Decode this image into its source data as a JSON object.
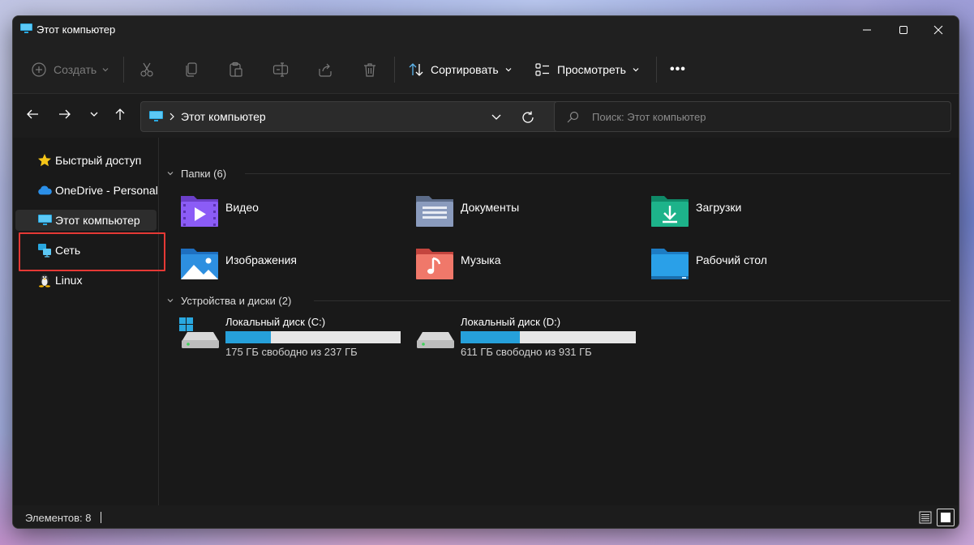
{
  "window": {
    "title": "Этот компьютер",
    "controls": [
      "minimize",
      "maximize",
      "close"
    ]
  },
  "toolbar": {
    "create_label": "Создать",
    "sort_label": "Сортировать",
    "view_label": "Просмотреть",
    "more_label": "•••",
    "disabled_actions": [
      "cut-icon",
      "copy-icon",
      "paste-icon",
      "rename-icon",
      "share-icon",
      "delete-icon"
    ]
  },
  "navigation": {
    "address_path": "Этот компьютер",
    "search_placeholder": "Поиск: Этот компьютер"
  },
  "sidebar": {
    "items": [
      {
        "label": "Быстрый доступ",
        "icon": "star-icon",
        "selected": false
      },
      {
        "label": "OneDrive - Personal",
        "icon": "cloud-icon",
        "selected": false
      },
      {
        "label": "Этот компьютер",
        "icon": "computer-icon",
        "selected": true
      },
      {
        "label": "Сеть",
        "icon": "network-icon",
        "selected": false,
        "highlighted": true
      },
      {
        "label": "Linux",
        "icon": "linux-icon",
        "selected": false
      }
    ]
  },
  "folders_section": {
    "title": "Папки (6)",
    "items": [
      {
        "name": "Видео",
        "icon": "video-folder-icon",
        "color": "#8b5cf6"
      },
      {
        "name": "Документы",
        "icon": "documents-folder-icon",
        "color": "#7a8aa8"
      },
      {
        "name": "Загрузки",
        "icon": "downloads-folder-icon",
        "color": "#1db38a"
      },
      {
        "name": "Изображения",
        "icon": "pictures-folder-icon",
        "color": "#2d8fe0"
      },
      {
        "name": "Музыка",
        "icon": "music-folder-icon",
        "color": "#e8675a"
      },
      {
        "name": "Рабочий стол",
        "icon": "desktop-folder-icon",
        "color": "#2aa0e8"
      }
    ]
  },
  "drives_section": {
    "title": "Устройства и диски (2)",
    "drives": [
      {
        "name": "Локальный диск (C:)",
        "free_text": "175 ГБ свободно из 237 ГБ",
        "used_fraction": 0.26,
        "windows_logo": true
      },
      {
        "name": "Локальный диск (D:)",
        "free_text": "611 ГБ свободно из 931 ГБ",
        "used_fraction": 0.34,
        "windows_logo": false
      }
    ]
  },
  "status": {
    "items_text": "Элементов: 8"
  },
  "colors": {
    "accent": "#26a0da",
    "highlight_border": "#e53935",
    "window_bg": "#191919"
  }
}
